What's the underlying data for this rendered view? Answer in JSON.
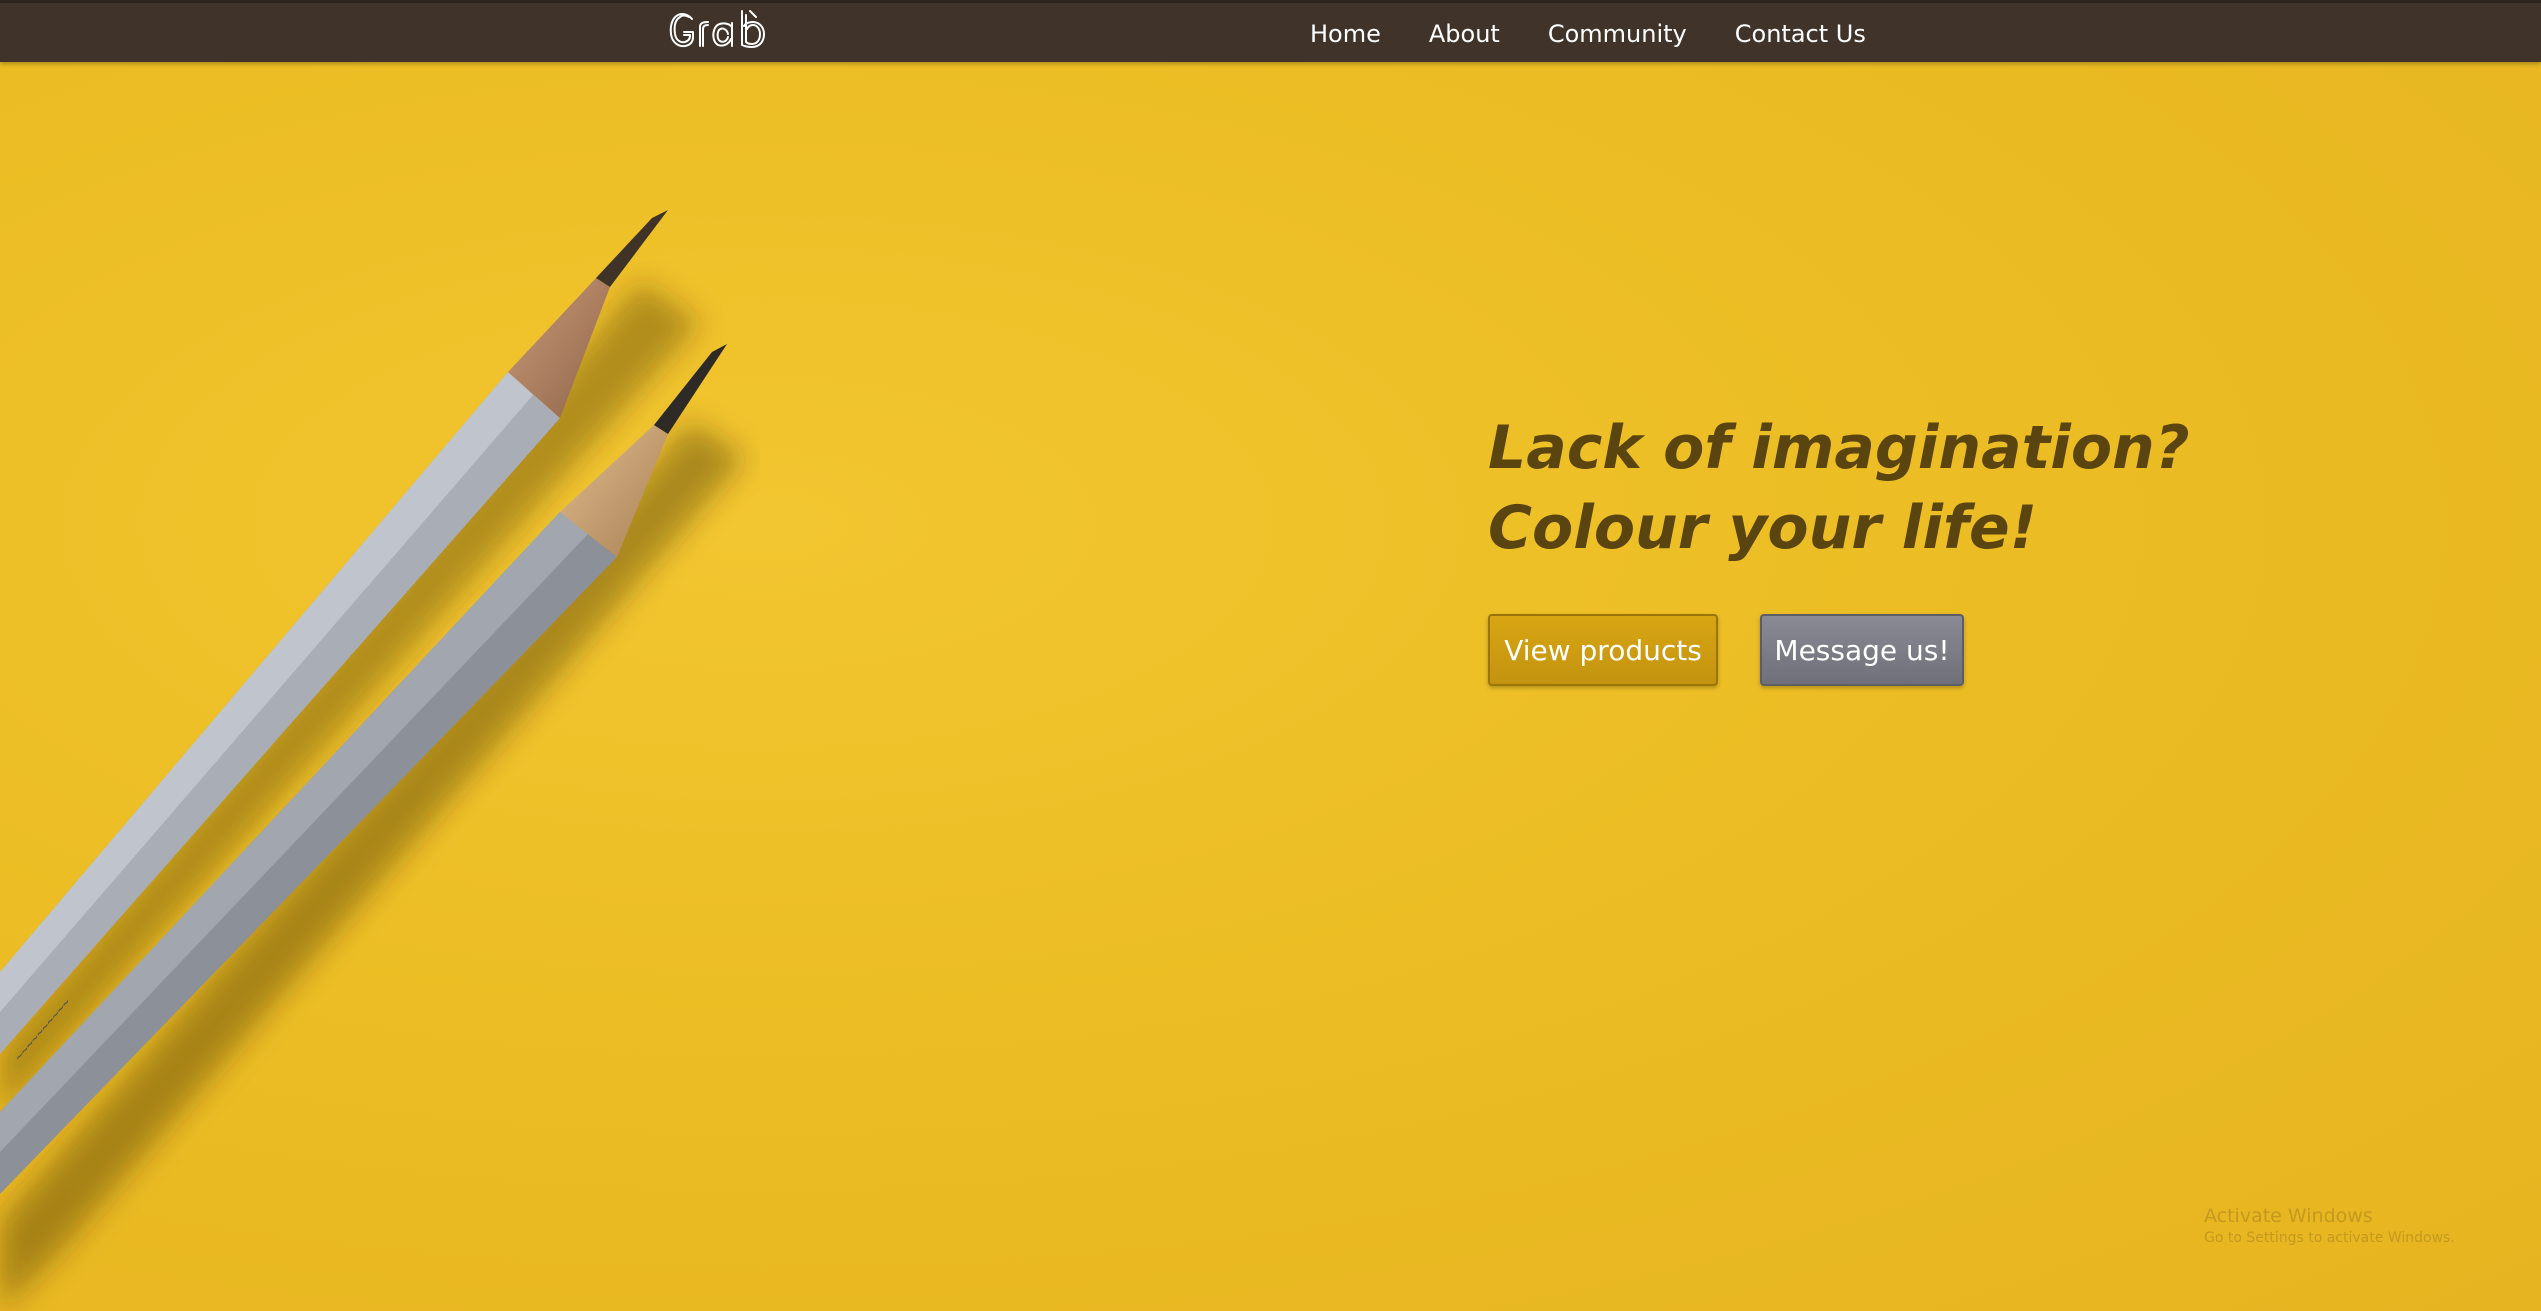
{
  "header": {
    "logo_text": "Grab",
    "nav": [
      {
        "label": "Home"
      },
      {
        "label": "About"
      },
      {
        "label": "Community"
      },
      {
        "label": "Contact Us"
      }
    ]
  },
  "hero": {
    "headline_line1": "Lack of imagination?",
    "headline_line2": "Colour your life!",
    "primary_button": "View products",
    "secondary_button": "Message us!"
  },
  "watermark": {
    "title": "Activate Windows",
    "subtitle": "Go to Settings to activate Windows."
  },
  "colors": {
    "background": "#ecbd24",
    "navbar": "#40342a",
    "headline": "#5a4510",
    "primary_button": "#c9990f",
    "secondary_button": "#7b7b84"
  },
  "icons": {
    "logo": "grab-logo",
    "illustration": "pencils-image"
  }
}
